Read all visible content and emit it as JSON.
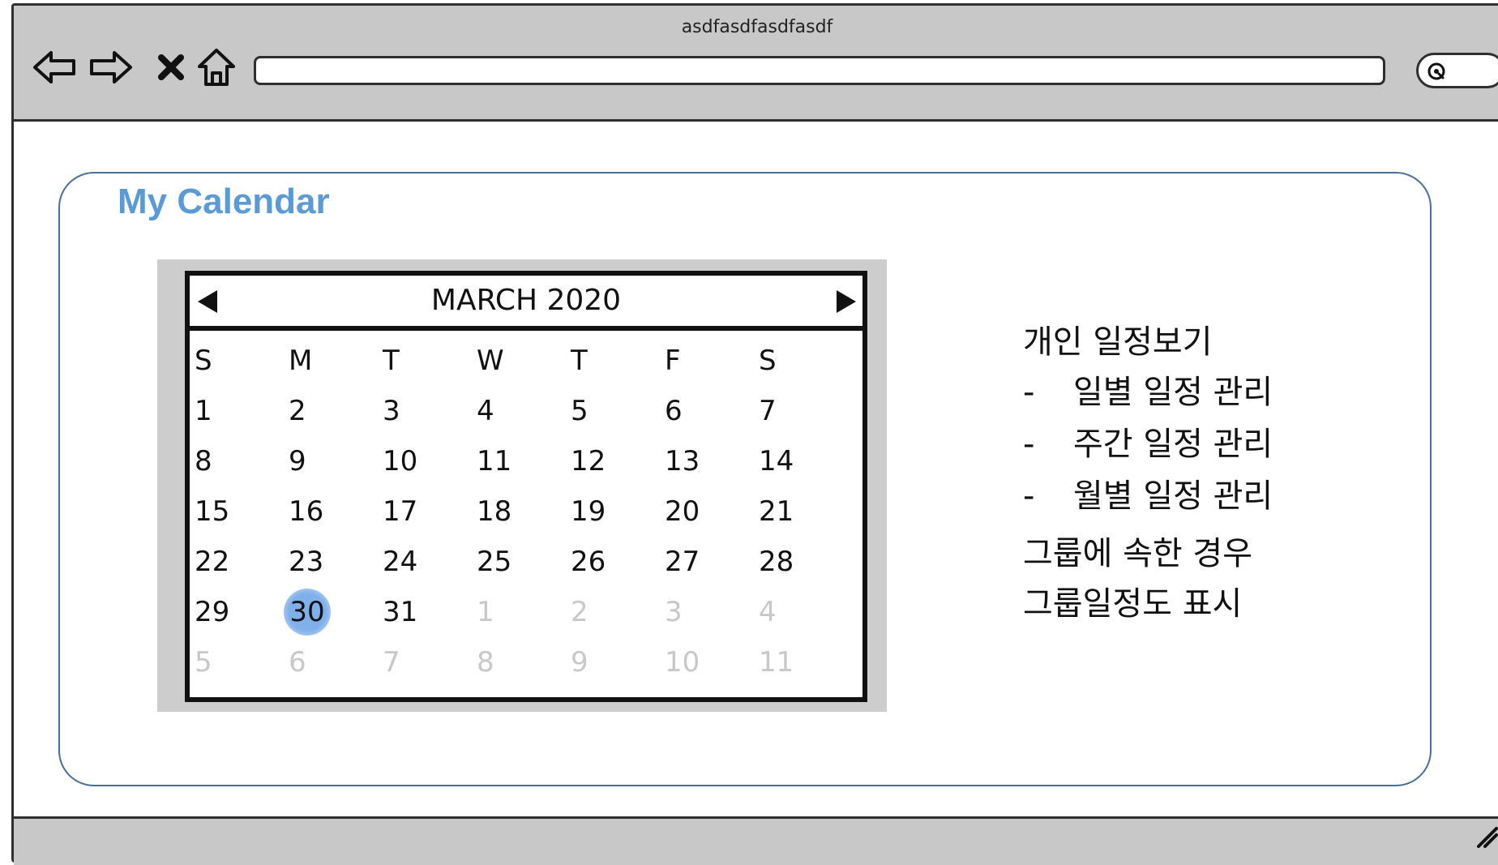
{
  "window": {
    "title": "asdfasdfasdfasdf"
  },
  "browser": {
    "icons": [
      "back-arrow-icon",
      "forward-arrow-icon",
      "close-icon",
      "home-icon",
      "search-icon"
    ],
    "address_value": ""
  },
  "panel": {
    "title": "My Calendar"
  },
  "calendar": {
    "month_label": "MARCH 2020",
    "weekdays": [
      "S",
      "M",
      "T",
      "W",
      "T",
      "F",
      "S"
    ],
    "weeks": [
      [
        {
          "d": "1",
          "m": false
        },
        {
          "d": "2",
          "m": false
        },
        {
          "d": "3",
          "m": false
        },
        {
          "d": "4",
          "m": false
        },
        {
          "d": "5",
          "m": false
        },
        {
          "d": "6",
          "m": false
        },
        {
          "d": "7",
          "m": false
        }
      ],
      [
        {
          "d": "8",
          "m": false
        },
        {
          "d": "9",
          "m": false
        },
        {
          "d": "10",
          "m": false
        },
        {
          "d": "11",
          "m": false
        },
        {
          "d": "12",
          "m": false
        },
        {
          "d": "13",
          "m": false
        },
        {
          "d": "14",
          "m": false
        }
      ],
      [
        {
          "d": "15",
          "m": false
        },
        {
          "d": "16",
          "m": false
        },
        {
          "d": "17",
          "m": false
        },
        {
          "d": "18",
          "m": false
        },
        {
          "d": "19",
          "m": false
        },
        {
          "d": "20",
          "m": false
        },
        {
          "d": "21",
          "m": false
        }
      ],
      [
        {
          "d": "22",
          "m": false
        },
        {
          "d": "23",
          "m": false
        },
        {
          "d": "24",
          "m": false
        },
        {
          "d": "25",
          "m": false
        },
        {
          "d": "26",
          "m": false
        },
        {
          "d": "27",
          "m": false
        },
        {
          "d": "28",
          "m": false
        }
      ],
      [
        {
          "d": "29",
          "m": false
        },
        {
          "d": "30",
          "m": false,
          "selected": true
        },
        {
          "d": "31",
          "m": false
        },
        {
          "d": "1",
          "m": true
        },
        {
          "d": "2",
          "m": true
        },
        {
          "d": "3",
          "m": true
        },
        {
          "d": "4",
          "m": true
        }
      ],
      [
        {
          "d": "5",
          "m": true
        },
        {
          "d": "6",
          "m": true
        },
        {
          "d": "7",
          "m": true
        },
        {
          "d": "8",
          "m": true
        },
        {
          "d": "9",
          "m": true
        },
        {
          "d": "10",
          "m": true
        },
        {
          "d": "11",
          "m": true
        }
      ]
    ],
    "selected_day": "30"
  },
  "notes": {
    "heading": "개인 일정보기",
    "bullets": [
      {
        "dash": "-",
        "text": "일별 일정 관리"
      },
      {
        "dash": "-",
        "text": "주간 일정 관리"
      },
      {
        "dash": "-",
        "text": "월별 일정 관리"
      }
    ],
    "group_lines": [
      "그룹에 속한 경우",
      "그룹일정도 표시"
    ]
  },
  "colors": {
    "accent": "#5b9bd5",
    "panel_border": "#4a6f96",
    "chrome": "#c8c8c8",
    "selected_day": "#7fb0ea",
    "muted_day": "#c8c8c8"
  }
}
